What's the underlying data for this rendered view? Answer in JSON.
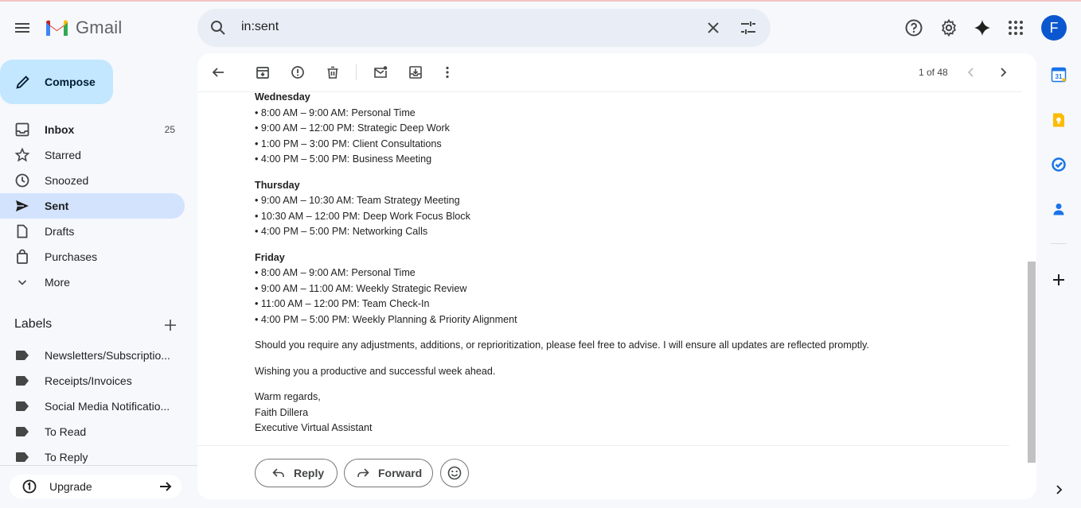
{
  "app": {
    "name": "Gmail"
  },
  "search": {
    "query": "in:sent"
  },
  "account": {
    "initial": "F",
    "color": "#0b57d0"
  },
  "compose": {
    "label": "Compose"
  },
  "nav": [
    {
      "label": "Inbox",
      "count": "25",
      "icon": "inbox-icon"
    },
    {
      "label": "Starred",
      "count": "",
      "icon": "star-icon"
    },
    {
      "label": "Snoozed",
      "count": "",
      "icon": "clock-icon"
    },
    {
      "label": "Sent",
      "count": "",
      "icon": "send-icon"
    },
    {
      "label": "Drafts",
      "count": "",
      "icon": "draft-icon"
    },
    {
      "label": "Purchases",
      "count": "",
      "icon": "shopping-bag-icon"
    },
    {
      "label": "More",
      "count": "",
      "icon": "chevron-down-icon"
    }
  ],
  "labels": {
    "heading": "Labels",
    "items": [
      "Newsletters/Subscriptio...",
      "Receipts/Invoices",
      "Social Media Notificatio...",
      "To Read",
      "To Reply"
    ]
  },
  "upgrade": {
    "label": "Upgrade"
  },
  "toolbar": {
    "pager": "1 of 48"
  },
  "message": {
    "days": [
      {
        "day": "Wednesday",
        "items": [
          "• 8:00 AM – 9:00 AM: Personal Time",
          "• 9:00 AM – 12:00 PM: Strategic Deep Work",
          "• 1:00 PM – 3:00 PM: Client Consultations",
          "• 4:00 PM – 5:00 PM: Business Meeting"
        ]
      },
      {
        "day": "Thursday",
        "items": [
          "• 9:00 AM – 10:30 AM: Team Strategy Meeting",
          "• 10:30 AM – 12:00 PM: Deep Work Focus Block",
          "• 4:00 PM – 5:00 PM: Networking Calls"
        ]
      },
      {
        "day": "Friday",
        "items": [
          "• 8:00 AM – 9:00 AM: Personal Time",
          "• 9:00 AM – 11:00 AM: Weekly Strategic Review",
          "• 11:00 AM – 12:00 PM: Team Check-In",
          "• 4:00 PM – 5:00 PM: Weekly Planning & Priority Alignment"
        ]
      }
    ],
    "closing_para": "Should you require any adjustments, additions, or reprioritization, please feel free to advise. I will ensure all updates are reflected promptly.",
    "wish": "Wishing you a productive and successful week ahead.",
    "signoff": "Warm regards,",
    "sender_name": "Faith Dillera",
    "sender_title": "Executive Virtual Assistant"
  },
  "actions": {
    "reply": "Reply",
    "forward": "Forward"
  },
  "colors": {
    "accent": "#0b57d0",
    "active_nav": "#d3e3fd",
    "compose_bg": "#c2e7ff"
  }
}
